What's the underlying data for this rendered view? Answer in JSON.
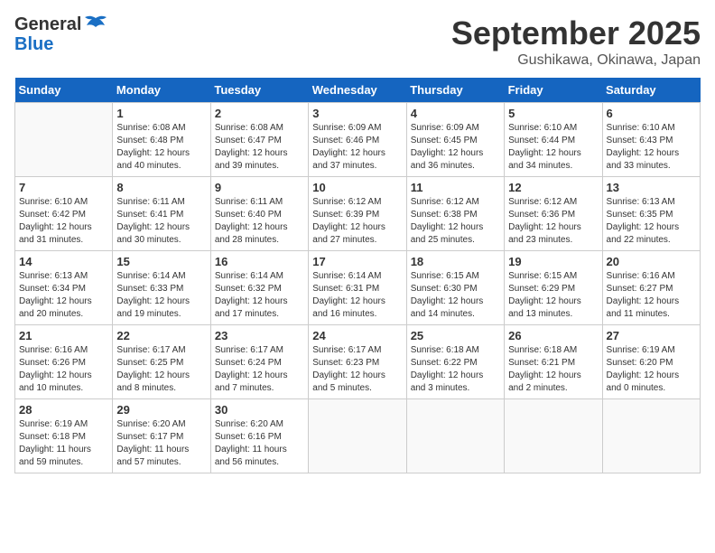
{
  "logo": {
    "general": "General",
    "blue": "Blue"
  },
  "header": {
    "month": "September 2025",
    "location": "Gushikawa, Okinawa, Japan"
  },
  "days_of_week": [
    "Sunday",
    "Monday",
    "Tuesday",
    "Wednesday",
    "Thursday",
    "Friday",
    "Saturday"
  ],
  "weeks": [
    [
      {
        "num": "",
        "info": ""
      },
      {
        "num": "1",
        "info": "Sunrise: 6:08 AM\nSunset: 6:48 PM\nDaylight: 12 hours\nand 40 minutes."
      },
      {
        "num": "2",
        "info": "Sunrise: 6:08 AM\nSunset: 6:47 PM\nDaylight: 12 hours\nand 39 minutes."
      },
      {
        "num": "3",
        "info": "Sunrise: 6:09 AM\nSunset: 6:46 PM\nDaylight: 12 hours\nand 37 minutes."
      },
      {
        "num": "4",
        "info": "Sunrise: 6:09 AM\nSunset: 6:45 PM\nDaylight: 12 hours\nand 36 minutes."
      },
      {
        "num": "5",
        "info": "Sunrise: 6:10 AM\nSunset: 6:44 PM\nDaylight: 12 hours\nand 34 minutes."
      },
      {
        "num": "6",
        "info": "Sunrise: 6:10 AM\nSunset: 6:43 PM\nDaylight: 12 hours\nand 33 minutes."
      }
    ],
    [
      {
        "num": "7",
        "info": "Sunrise: 6:10 AM\nSunset: 6:42 PM\nDaylight: 12 hours\nand 31 minutes."
      },
      {
        "num": "8",
        "info": "Sunrise: 6:11 AM\nSunset: 6:41 PM\nDaylight: 12 hours\nand 30 minutes."
      },
      {
        "num": "9",
        "info": "Sunrise: 6:11 AM\nSunset: 6:40 PM\nDaylight: 12 hours\nand 28 minutes."
      },
      {
        "num": "10",
        "info": "Sunrise: 6:12 AM\nSunset: 6:39 PM\nDaylight: 12 hours\nand 27 minutes."
      },
      {
        "num": "11",
        "info": "Sunrise: 6:12 AM\nSunset: 6:38 PM\nDaylight: 12 hours\nand 25 minutes."
      },
      {
        "num": "12",
        "info": "Sunrise: 6:12 AM\nSunset: 6:36 PM\nDaylight: 12 hours\nand 23 minutes."
      },
      {
        "num": "13",
        "info": "Sunrise: 6:13 AM\nSunset: 6:35 PM\nDaylight: 12 hours\nand 22 minutes."
      }
    ],
    [
      {
        "num": "14",
        "info": "Sunrise: 6:13 AM\nSunset: 6:34 PM\nDaylight: 12 hours\nand 20 minutes."
      },
      {
        "num": "15",
        "info": "Sunrise: 6:14 AM\nSunset: 6:33 PM\nDaylight: 12 hours\nand 19 minutes."
      },
      {
        "num": "16",
        "info": "Sunrise: 6:14 AM\nSunset: 6:32 PM\nDaylight: 12 hours\nand 17 minutes."
      },
      {
        "num": "17",
        "info": "Sunrise: 6:14 AM\nSunset: 6:31 PM\nDaylight: 12 hours\nand 16 minutes."
      },
      {
        "num": "18",
        "info": "Sunrise: 6:15 AM\nSunset: 6:30 PM\nDaylight: 12 hours\nand 14 minutes."
      },
      {
        "num": "19",
        "info": "Sunrise: 6:15 AM\nSunset: 6:29 PM\nDaylight: 12 hours\nand 13 minutes."
      },
      {
        "num": "20",
        "info": "Sunrise: 6:16 AM\nSunset: 6:27 PM\nDaylight: 12 hours\nand 11 minutes."
      }
    ],
    [
      {
        "num": "21",
        "info": "Sunrise: 6:16 AM\nSunset: 6:26 PM\nDaylight: 12 hours\nand 10 minutes."
      },
      {
        "num": "22",
        "info": "Sunrise: 6:17 AM\nSunset: 6:25 PM\nDaylight: 12 hours\nand 8 minutes."
      },
      {
        "num": "23",
        "info": "Sunrise: 6:17 AM\nSunset: 6:24 PM\nDaylight: 12 hours\nand 7 minutes."
      },
      {
        "num": "24",
        "info": "Sunrise: 6:17 AM\nSunset: 6:23 PM\nDaylight: 12 hours\nand 5 minutes."
      },
      {
        "num": "25",
        "info": "Sunrise: 6:18 AM\nSunset: 6:22 PM\nDaylight: 12 hours\nand 3 minutes."
      },
      {
        "num": "26",
        "info": "Sunrise: 6:18 AM\nSunset: 6:21 PM\nDaylight: 12 hours\nand 2 minutes."
      },
      {
        "num": "27",
        "info": "Sunrise: 6:19 AM\nSunset: 6:20 PM\nDaylight: 12 hours\nand 0 minutes."
      }
    ],
    [
      {
        "num": "28",
        "info": "Sunrise: 6:19 AM\nSunset: 6:18 PM\nDaylight: 11 hours\nand 59 minutes."
      },
      {
        "num": "29",
        "info": "Sunrise: 6:20 AM\nSunset: 6:17 PM\nDaylight: 11 hours\nand 57 minutes."
      },
      {
        "num": "30",
        "info": "Sunrise: 6:20 AM\nSunset: 6:16 PM\nDaylight: 11 hours\nand 56 minutes."
      },
      {
        "num": "",
        "info": ""
      },
      {
        "num": "",
        "info": ""
      },
      {
        "num": "",
        "info": ""
      },
      {
        "num": "",
        "info": ""
      }
    ]
  ]
}
